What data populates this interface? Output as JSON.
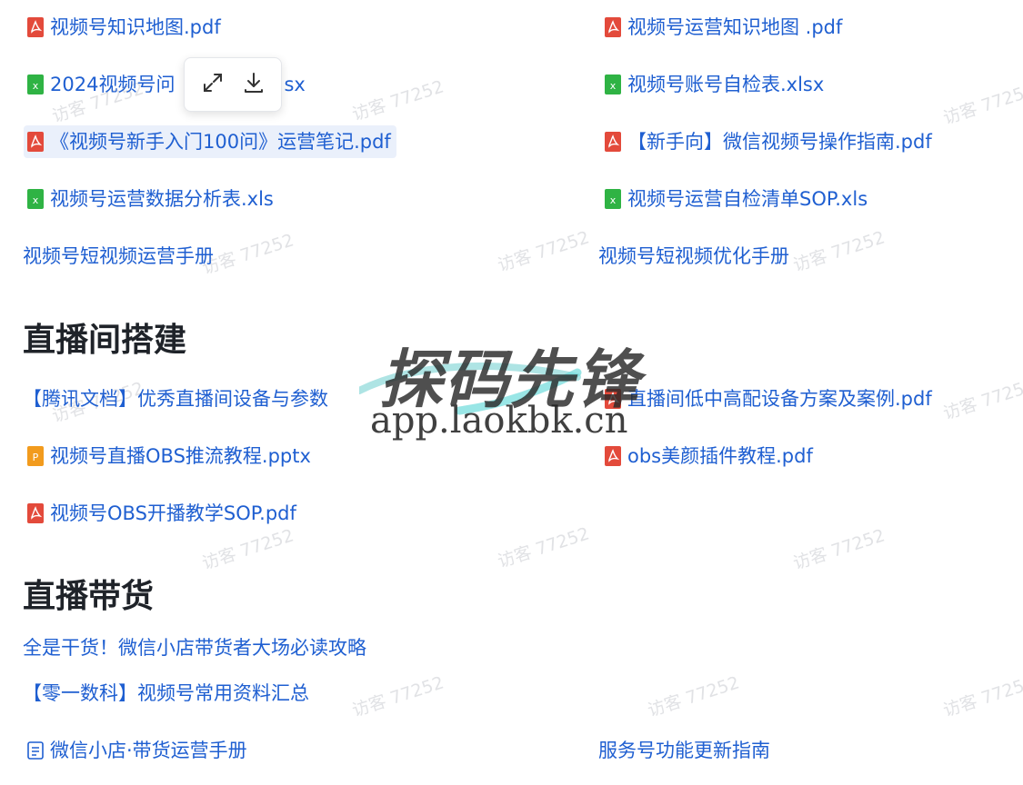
{
  "colors": {
    "link": "#1f5fd1",
    "pdf": "#e34a3b",
    "xls": "#2fb344",
    "ppt": "#f29b1d",
    "heading": "#1f2329"
  },
  "sections": {
    "top": {
      "left": [
        {
          "icon": "pdf-file-icon",
          "label": "视频号知识地图.pdf"
        },
        {
          "icon": "excel-file-icon",
          "label": "2024视频号问",
          "label_tail": "sx"
        },
        {
          "icon": "pdf-file-icon",
          "label": "《视频号新手入门100问》运营笔记.pdf"
        },
        {
          "icon": "excel-file-icon",
          "label": "视频号运营数据分析表.xls"
        },
        {
          "label": "视频号短视频运营手册"
        }
      ],
      "right": [
        {
          "icon": "pdf-file-icon",
          "label": "视频号运营知识地图 .pdf"
        },
        {
          "icon": "excel-file-icon",
          "label": "视频号账号自检表.xlsx"
        },
        {
          "icon": "pdf-file-icon",
          "label": "【新手向】微信视频号操作指南.pdf"
        },
        {
          "icon": "excel-file-icon",
          "label": "视频号运营自检清单SOP.xls"
        },
        {
          "label": "视频号短视频优化手册"
        }
      ]
    },
    "live_setup": {
      "title": "直播间搭建",
      "left": [
        {
          "label": "【腾讯文档】优秀直播间设备与参数"
        },
        {
          "icon": "ppt-file-icon",
          "label": "视频号直播OBS推流教程.pptx"
        },
        {
          "icon": "pdf-file-icon",
          "label": "视频号OBS开播教学SOP.pdf"
        }
      ],
      "right": [
        {
          "icon": "pdf-file-icon",
          "label": "直播间低中高配设备方案及案例.pdf"
        },
        {
          "icon": "pdf-file-icon",
          "label": "obs美颜插件教程.pdf"
        }
      ]
    },
    "live_sales": {
      "title": "直播带货",
      "left": [
        {
          "label": "全是干货！微信小店带货者大场必读攻略"
        },
        {
          "label": "【零一数科】视频号常用资料汇总"
        },
        {
          "icon": "doc-file-icon",
          "label": "微信小店·带货运营手册"
        }
      ],
      "right": [
        {
          "label": "服务号功能更新指南"
        }
      ]
    }
  },
  "popup": {
    "expand_icon": "expand-icon",
    "download_icon": "download-icon"
  },
  "watermark": {
    "text": "访客 77252"
  },
  "logo": {
    "title": "探码先锋",
    "url": "app.laokbk.cn"
  }
}
